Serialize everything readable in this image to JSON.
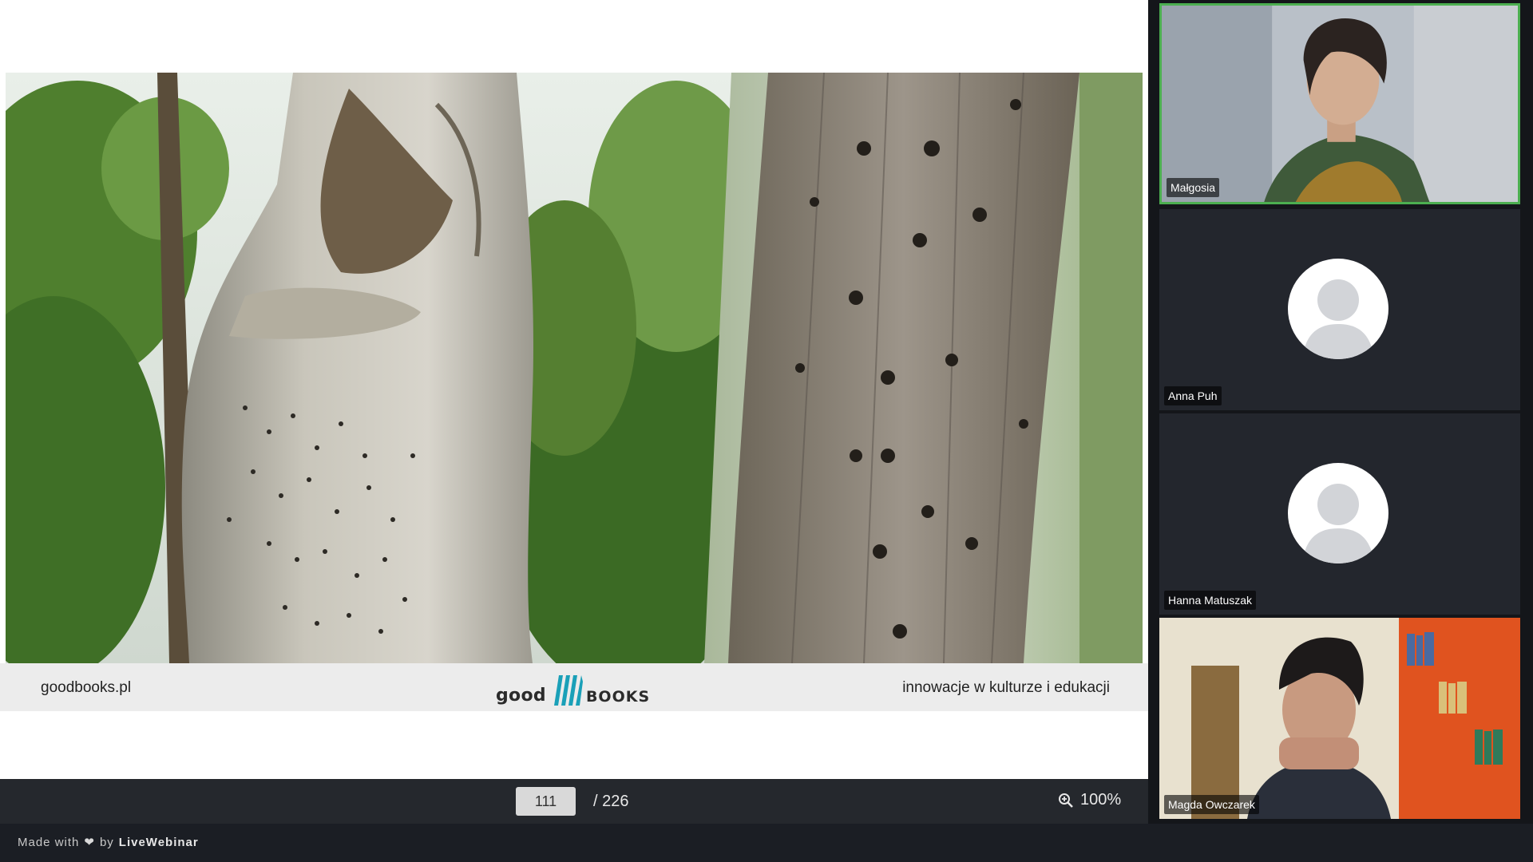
{
  "slide": {
    "footer_left": "goodbooks.pl",
    "footer_right": "innowacje w kulturze i edukacji",
    "logo_left": "good",
    "logo_right": "BOOKS"
  },
  "pager": {
    "current_page": "111",
    "total": "/ 226",
    "zoom": "100%"
  },
  "credit": {
    "prefix": "Made with",
    "heart": "❤",
    "by": "by",
    "brand": "LiveWebinar"
  },
  "participants": [
    {
      "name": "Małgosia",
      "video": true,
      "speaking": true
    },
    {
      "name": "Anna Puh",
      "video": false
    },
    {
      "name": "Hanna Matuszak",
      "video": false
    },
    {
      "name": "Magda Owczarek",
      "video": true
    }
  ],
  "colors": {
    "accent_speaking": "#4caf50",
    "logo_bars": "#1aa0b8",
    "pager_bg": "#25282d"
  },
  "icons": [
    "zoom-in-icon",
    "heart-icon",
    "user-placeholder-icon"
  ]
}
